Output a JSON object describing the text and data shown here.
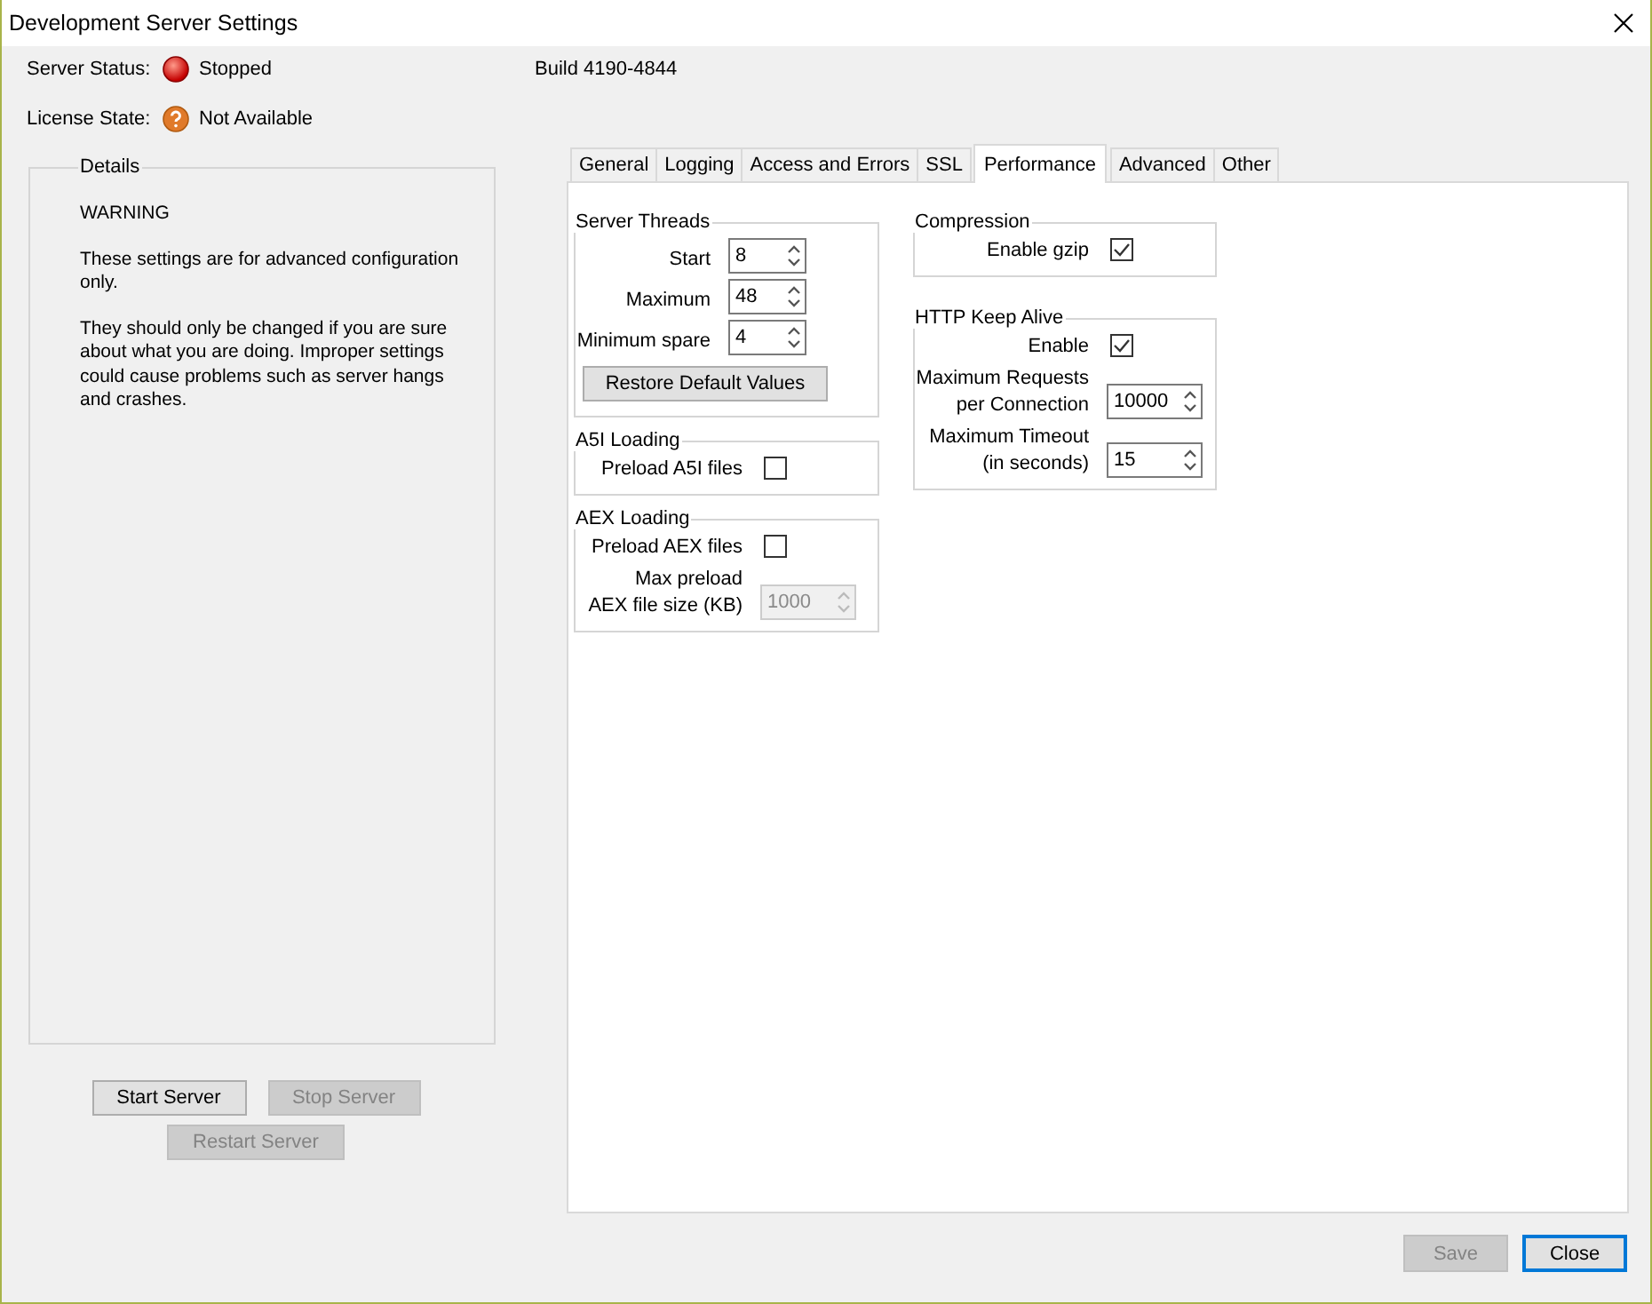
{
  "window": {
    "title": "Development Server Settings"
  },
  "status": [
    {
      "label": "Server Status:",
      "value": "Stopped",
      "kind": "stopped"
    },
    {
      "label": "License State:",
      "value": "Not Available",
      "kind": "unknown"
    }
  ],
  "build": "Build 4190-4844",
  "details": {
    "title": "Details",
    "paragraphs": [
      "WARNING",
      "These settings are for advanced configuration only.",
      "They should only be changed if you are sure about what you are doing. Improper settings could cause problems such as server hangs and crashes."
    ]
  },
  "server_buttons": [
    {
      "label": "Start Server",
      "disabled": false
    },
    {
      "label": "Stop Server",
      "disabled": true
    },
    {
      "label": "Restart Server",
      "disabled": true
    }
  ],
  "tabs": [
    {
      "label": "General",
      "selected": false
    },
    {
      "label": "Logging",
      "selected": false
    },
    {
      "label": "Access and Errors",
      "selected": false
    },
    {
      "label": "SSL",
      "selected": false
    },
    {
      "label": "Performance",
      "selected": true
    },
    {
      "label": "Advanced",
      "selected": false
    },
    {
      "label": "Other",
      "selected": false
    }
  ],
  "columns": [
    {
      "groups": [
        {
          "title": "Server Threads",
          "items": [
            {
              "kind": "spinner",
              "label": "Start",
              "value": "8",
              "disabled": false
            },
            {
              "kind": "spinner",
              "label": "Maximum",
              "value": "48",
              "disabled": false
            },
            {
              "kind": "spinner",
              "label": "Minimum spare",
              "value": "4",
              "disabled": false
            },
            {
              "kind": "button",
              "label": "Restore Default Values"
            }
          ]
        },
        {
          "title": "A5I Loading",
          "items": [
            {
              "kind": "checkbox",
              "label": "Preload A5I files",
              "checked": false
            }
          ]
        },
        {
          "title": "AEX Loading",
          "items": [
            {
              "kind": "checkbox",
              "label": "Preload AEX files",
              "checked": false
            },
            {
              "kind": "spinner",
              "label": "Max preload\nAEX file size (KB)",
              "value": "1000",
              "disabled": true
            }
          ]
        }
      ]
    },
    {
      "groups": [
        {
          "title": "Compression",
          "items": [
            {
              "kind": "checkbox",
              "label": "Enable gzip",
              "checked": true
            }
          ]
        },
        {
          "title": "HTTP Keep Alive",
          "items": [
            {
              "kind": "checkbox",
              "label": "Enable",
              "checked": true
            },
            {
              "kind": "spinner",
              "label": "Maximum Requests\nper Connection",
              "value": "10000",
              "disabled": false
            },
            {
              "kind": "spinner",
              "label": "Maximum Timeout\n(in seconds)",
              "value": "15",
              "disabled": false
            }
          ]
        }
      ]
    }
  ],
  "footer_buttons": [
    {
      "label": "Save",
      "disabled": true,
      "default": false
    },
    {
      "label": "Close",
      "disabled": false,
      "default": true
    }
  ]
}
